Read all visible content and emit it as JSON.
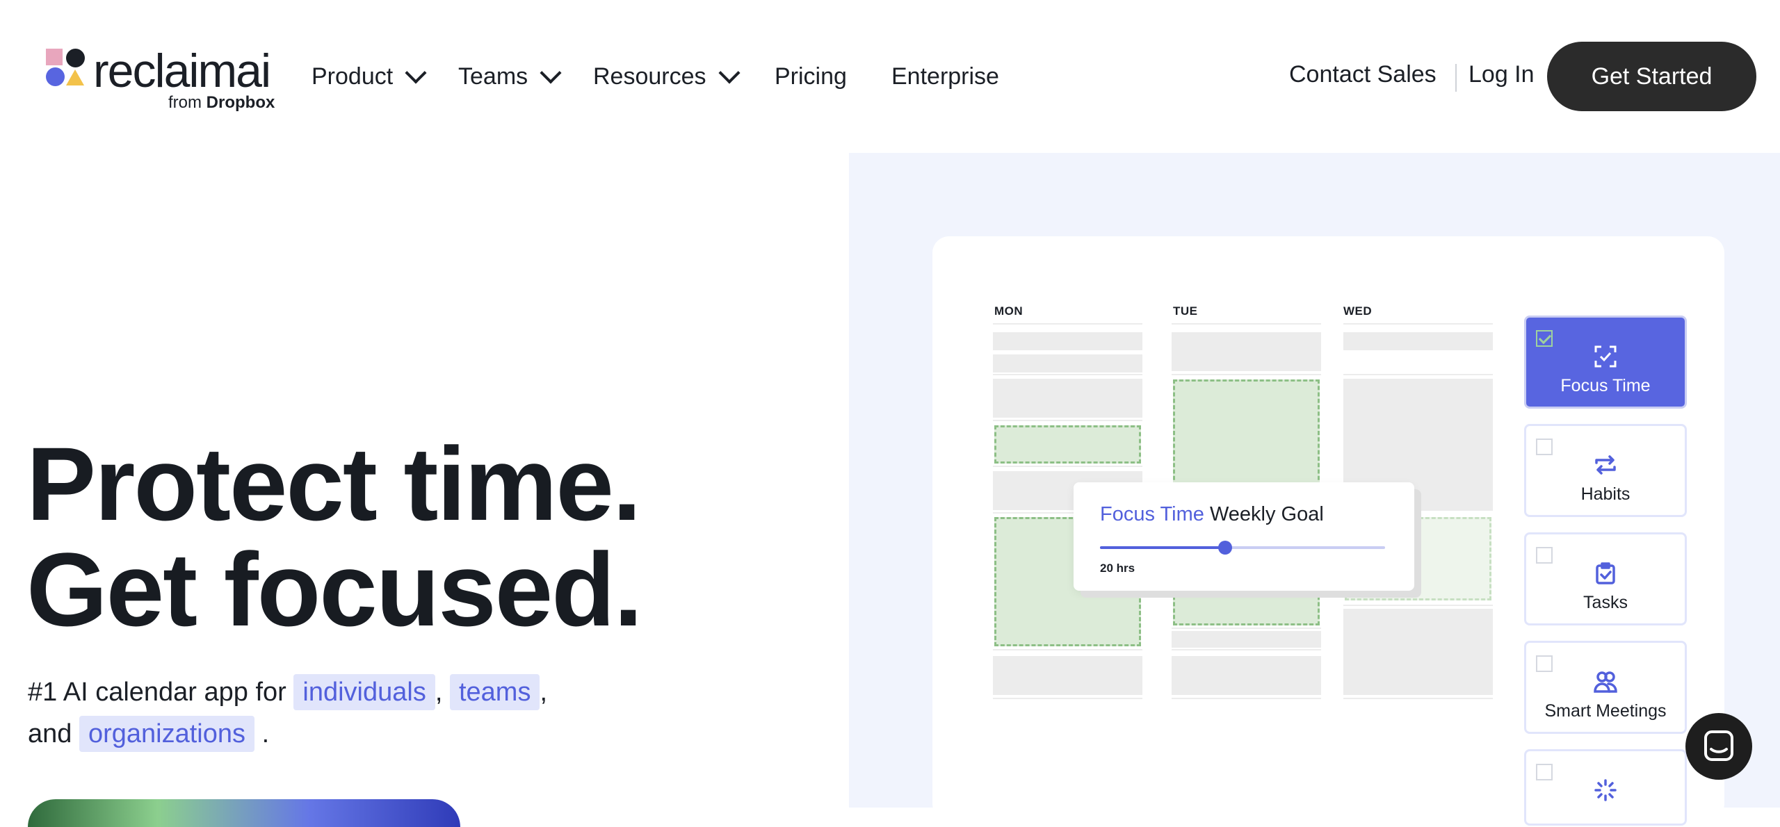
{
  "brand": {
    "name": "reclaimai",
    "from_prefix": "from",
    "from_brand": "Dropbox"
  },
  "nav": {
    "product": "Product",
    "teams": "Teams",
    "resources": "Resources",
    "pricing": "Pricing",
    "enterprise": "Enterprise"
  },
  "header_right": {
    "contact": "Contact Sales",
    "login": "Log In",
    "cta": "Get Started"
  },
  "hero": {
    "line1": "Protect time.",
    "line2": "Get focused.",
    "sub_prefix": "#1 AI calendar app for",
    "chip1": "individuals",
    "comma1": ",",
    "chip2": "teams",
    "comma2": ",",
    "and": "and",
    "chip3": "organizations",
    "period": "."
  },
  "calendar": {
    "days": [
      "MON",
      "TUE",
      "WED"
    ]
  },
  "goal_popup": {
    "highlight": "Focus Time",
    "rest": "Weekly Goal",
    "value_label": "20 hrs",
    "slider_fraction": 0.44
  },
  "features": [
    {
      "label": "Focus Time",
      "icon": "focus-frame-icon",
      "active": true
    },
    {
      "label": "Habits",
      "icon": "repeat-icon",
      "active": false
    },
    {
      "label": "Tasks",
      "icon": "clipboard-check-icon",
      "active": false
    },
    {
      "label": "Smart Meetings",
      "icon": "people-icon",
      "active": false
    },
    {
      "label": "",
      "icon": "loading-spinner-icon",
      "active": false
    }
  ],
  "colors": {
    "accent": "#5865e0",
    "chip_bg": "#e1e5fb",
    "cta_bg": "#2b2b2b",
    "panel_bg": "#f1f4fd",
    "green_block": "#dcebd8"
  }
}
